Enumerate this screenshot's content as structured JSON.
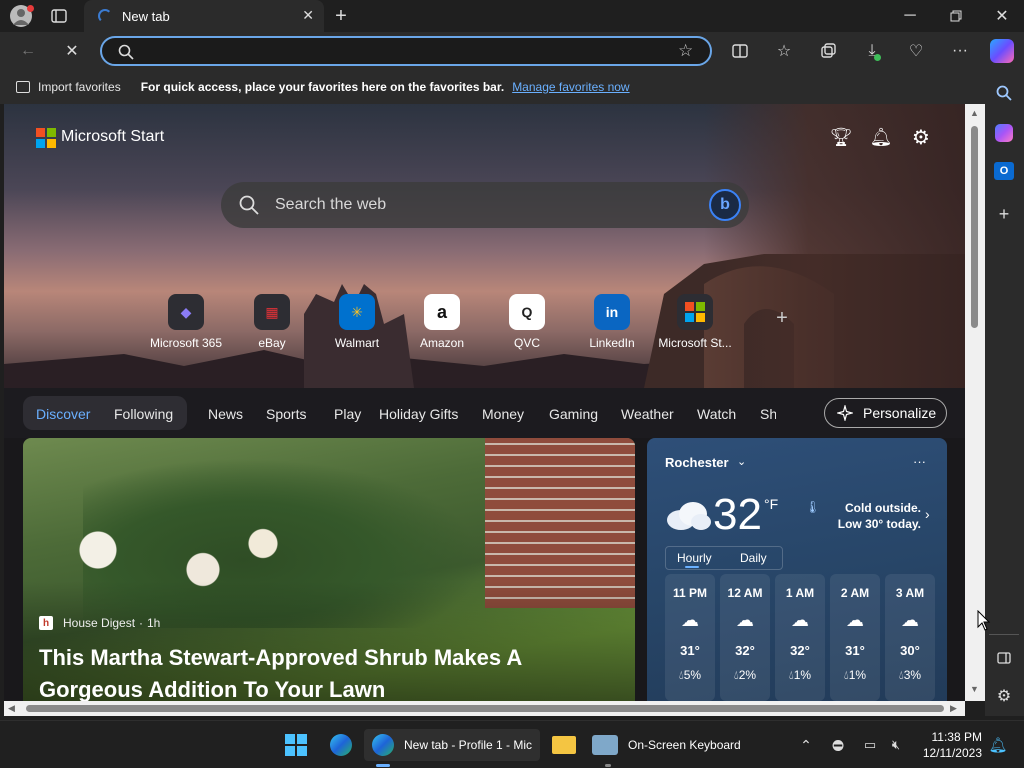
{
  "browser": {
    "tab_title": "New tab",
    "address_value": "",
    "favorites_bar": {
      "import_label": "Import favorites",
      "hint": "For quick access, place your favorites here on the favorites bar.",
      "manage_link": "Manage favorites now"
    }
  },
  "page": {
    "brand": "Microsoft Start",
    "search_placeholder": "Search the web",
    "shortcuts": [
      {
        "label": "Microsoft 365",
        "glyph": "◆",
        "color": "#6c5ce7"
      },
      {
        "label": "eBay",
        "glyph": "▦",
        "color": "#e53238"
      },
      {
        "label": "Walmart",
        "glyph": "✳",
        "color": "#0071ce"
      },
      {
        "label": "Amazon",
        "glyph": "a",
        "color": "#ffffff"
      },
      {
        "label": "QVC",
        "glyph": "Q",
        "color": "#ffffff"
      },
      {
        "label": "LinkedIn",
        "glyph": "in",
        "color": "#0a66c2"
      },
      {
        "label": "Microsoft St...",
        "glyph": "⊞",
        "color": "#f25022"
      }
    ],
    "nav": {
      "items": [
        "Discover",
        "Following",
        "News",
        "Sports",
        "Play",
        "Holiday Gifts",
        "Money",
        "Gaming",
        "Weather",
        "Watch",
        "Sh"
      ],
      "active": "Discover",
      "personalize_label": "Personalize"
    },
    "article": {
      "source": "House Digest",
      "age": "1h",
      "headline": "This Martha Stewart-Approved Shrub Makes A Gorgeous Addition To Your Lawn"
    },
    "weather": {
      "location": "Rochester",
      "temperature": "32",
      "unit": "°F",
      "note": "Cold outside. Low 30° today.",
      "tabs": [
        "Hourly",
        "Daily"
      ],
      "hourly": [
        {
          "time": "11 PM",
          "icon": "partly-cloudy-night",
          "temp": "31°",
          "precip": "5%"
        },
        {
          "time": "12 AM",
          "icon": "partly-cloudy-night",
          "temp": "32°",
          "precip": "2%"
        },
        {
          "time": "1 AM",
          "icon": "partly-cloudy-night",
          "temp": "32°",
          "precip": "1%"
        },
        {
          "time": "2 AM",
          "icon": "partly-cloudy-night",
          "temp": "31°",
          "precip": "1%"
        },
        {
          "time": "3 AM",
          "icon": "cloudy",
          "temp": "30°",
          "precip": "3%"
        }
      ]
    }
  },
  "taskbar": {
    "edge_label": "New tab - Profile 1 - Mic",
    "osk_label": "On-Screen Keyboard",
    "time": "11:38 PM",
    "date": "12/11/2023"
  },
  "colors": {
    "accent": "#6aa6e8",
    "link": "#6ab0ff",
    "active_nav": "#6ab0ff"
  }
}
